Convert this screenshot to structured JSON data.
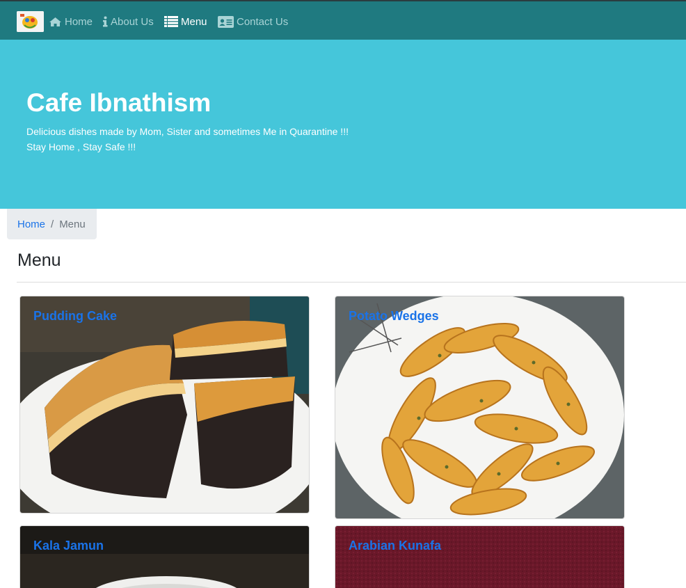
{
  "navbar": {
    "logo_icon": "cafe-logo-icon",
    "items": [
      {
        "label": "Home",
        "icon": "home-icon"
      },
      {
        "label": "About Us",
        "icon": "info-icon"
      },
      {
        "label": "Menu",
        "icon": "list-icon",
        "active": true
      },
      {
        "label": "Contact Us",
        "icon": "contact-card-icon"
      }
    ]
  },
  "jumbotron": {
    "title": "Cafe Ibnathism",
    "tagline_line1": "Delicious dishes made by Mom, Sister and sometimes Me in Quarantine !!!",
    "tagline_line2": "Stay Home , Stay Safe !!!"
  },
  "breadcrumb": {
    "home": "Home",
    "separator": "/",
    "current": "Menu"
  },
  "page": {
    "title": "Menu"
  },
  "menu_items": [
    {
      "name": "Pudding Cake"
    },
    {
      "name": "Potato Wedges"
    },
    {
      "name": "Kala Jamun"
    },
    {
      "name": "Arabian Kunafa"
    }
  ],
  "colors": {
    "navbar": "#1f7a80",
    "jumbotron": "#45c6da",
    "link": "#1a73e8",
    "breadcrumb_bg": "#e9ecef"
  }
}
